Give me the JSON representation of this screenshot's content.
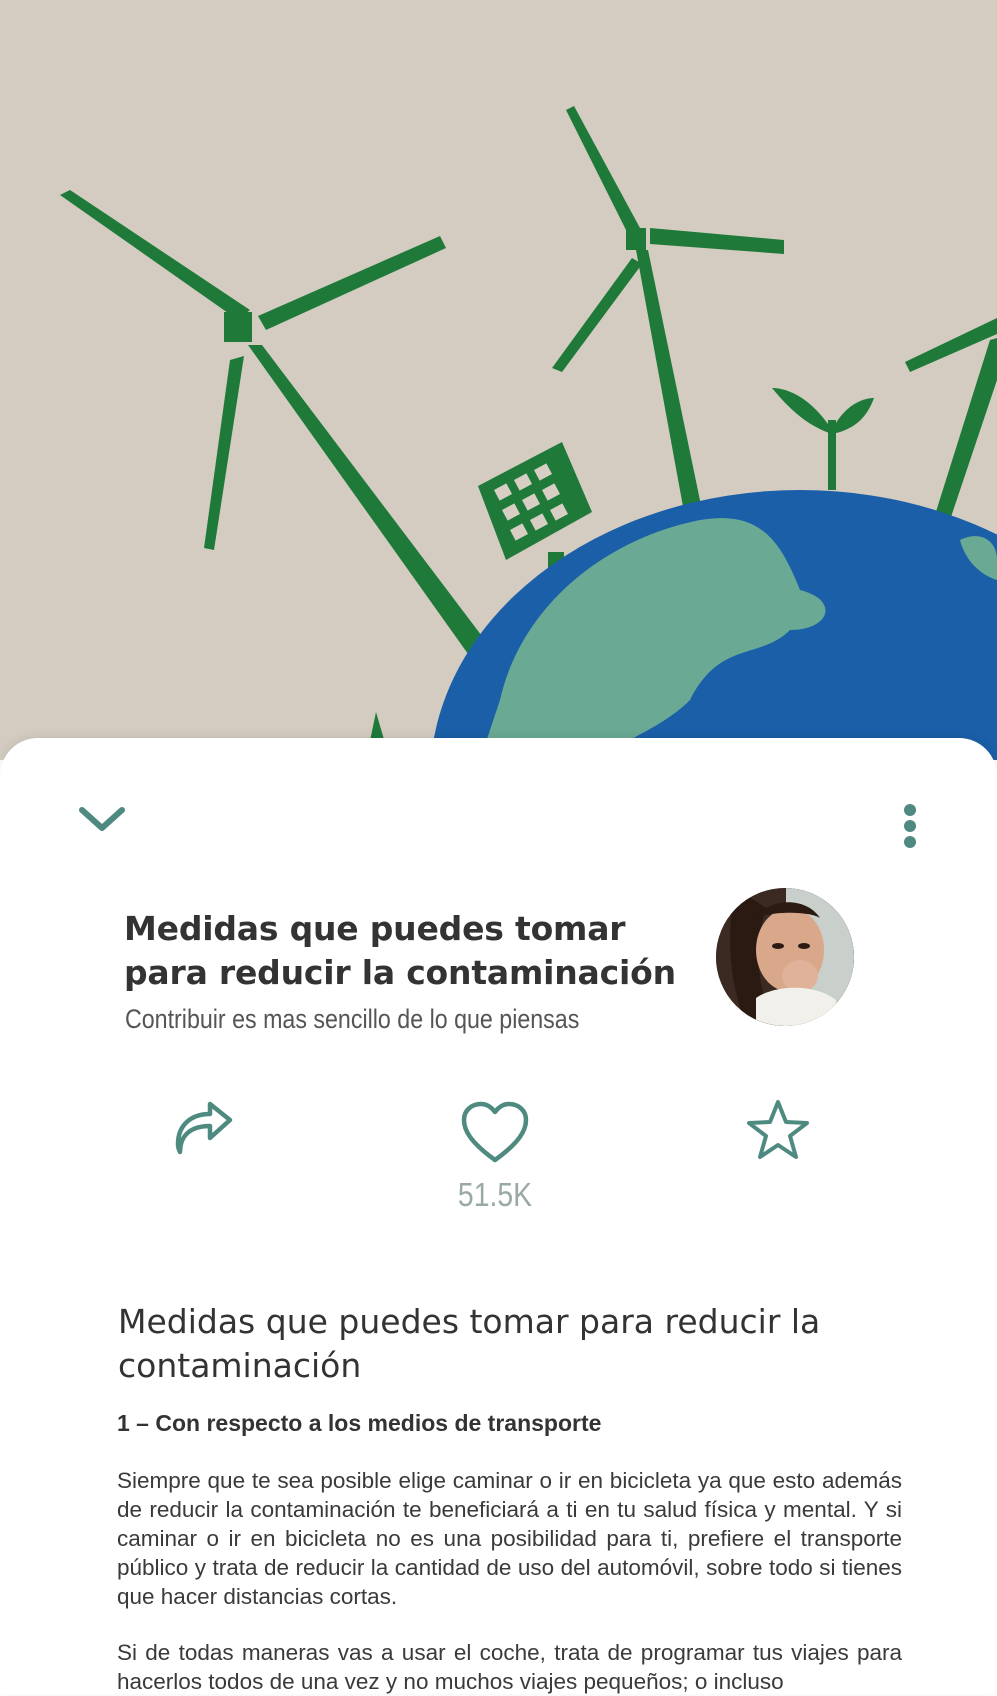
{
  "hero": {
    "image": "wind-turbines-earth-illustration"
  },
  "toolbar": {
    "collapse_icon": "chevron-down-icon",
    "more_icon": "more-vertical-icon"
  },
  "header": {
    "title": "Medidas que puedes tomar para reducir la contaminación",
    "subtitle": "Contribuir es mas sencillo de lo que piensas"
  },
  "actions": {
    "share_icon": "share-icon",
    "like_icon": "heart-icon",
    "like_count": "51.5K",
    "favorite_icon": "star-icon"
  },
  "article": {
    "title": "Medidas que puedes tomar para reducir la contaminación",
    "section_1": "1 – Con respecto a los medios de transporte",
    "paragraph_1": "Siempre que te sea posible elige caminar o ir en bicicleta ya que esto además de reducir la contaminación te beneficiará a ti en tu salud física y mental. Y si caminar o ir en bicicleta no es una posibilidad para ti, prefiere el transporte público y trata de reducir la cantidad de uso del automóvil, sobre todo si tienes que hacer distancias cortas.",
    "paragraph_2": "Si de todas maneras vas a usar el coche, trata de programar tus viajes para hacerlos todos de una vez y no muchos viajes pequeños; o incluso"
  },
  "colors": {
    "accent": "#4f8a80",
    "green": "#1e7a3a",
    "ocean": "#1a5fa8",
    "land": "#6aaa95",
    "paper": "#d8d0c4"
  }
}
